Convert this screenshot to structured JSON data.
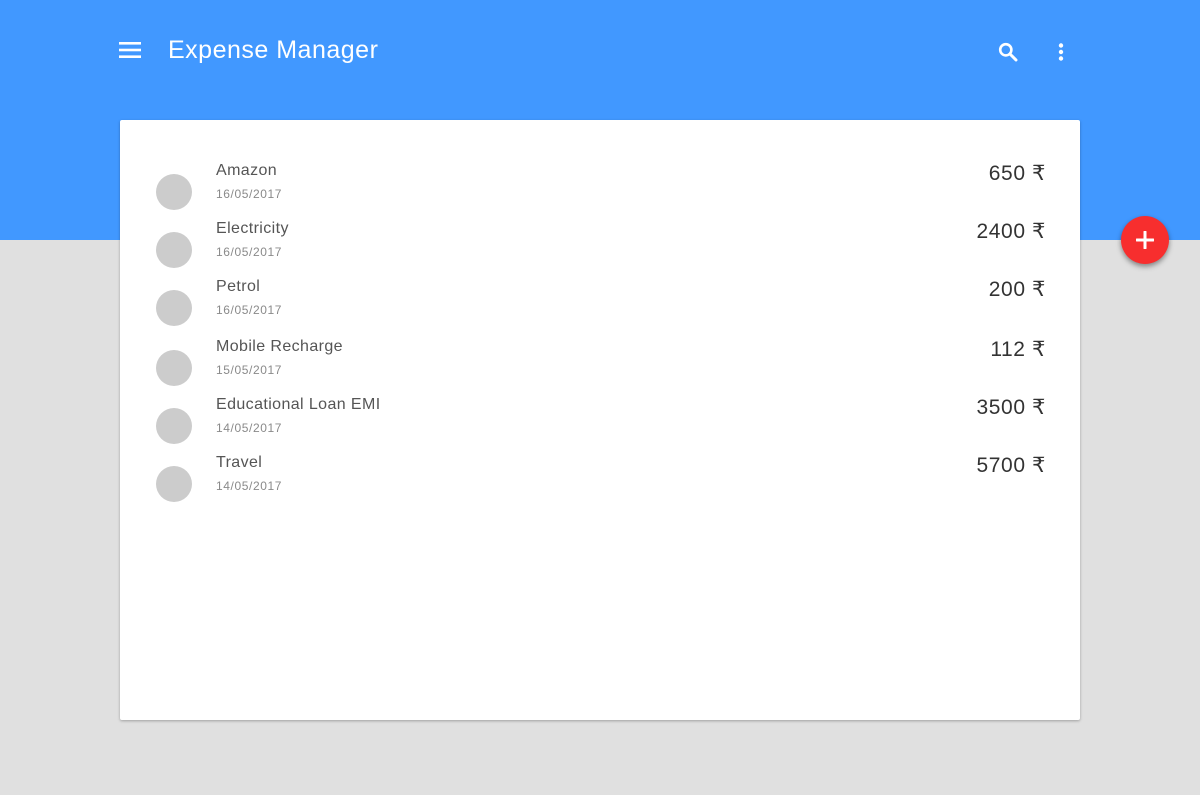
{
  "app": {
    "title": "Expense Manager",
    "colors": {
      "appbar": "#4198ff",
      "background": "#e0e0e0",
      "fab": "#f72e2e",
      "avatar": "#cccccc"
    }
  },
  "toolbar": {
    "menu_icon": "menu-icon",
    "search_icon": "search-icon",
    "more_icon": "more-vert-icon"
  },
  "expenses": [
    {
      "name": "Amazon",
      "date": "16/05/2017",
      "amount": "650 ₹"
    },
    {
      "name": "Electricity",
      "date": "16/05/2017",
      "amount": "2400 ₹"
    },
    {
      "name": "Petrol",
      "date": "16/05/2017",
      "amount": "200 ₹"
    },
    {
      "name": "Mobile Recharge",
      "date": "15/05/2017",
      "amount": "112 ₹"
    },
    {
      "name": "Educational Loan EMI",
      "date": "14/05/2017",
      "amount": "3500 ₹"
    },
    {
      "name": "Travel",
      "date": "14/05/2017",
      "amount": "5700 ₹"
    }
  ],
  "fab": {
    "icon": "add-icon"
  }
}
